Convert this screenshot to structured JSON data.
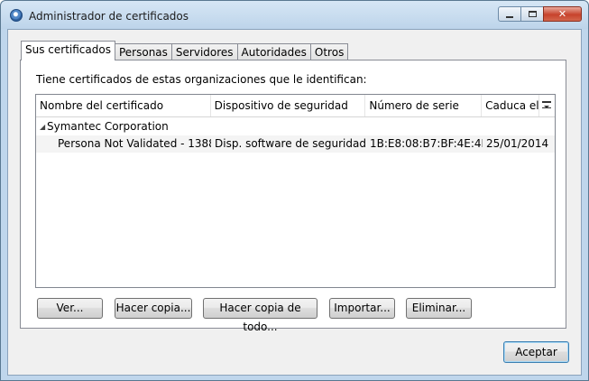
{
  "window": {
    "title": "Administrador de certificados",
    "accent": "#bfd6ec",
    "close_glyph": "✕"
  },
  "tabs": [
    {
      "label": "Sus certificados",
      "active": true
    },
    {
      "label": "Personas",
      "active": false
    },
    {
      "label": "Servidores",
      "active": false
    },
    {
      "label": "Autoridades",
      "active": false
    },
    {
      "label": "Otros",
      "active": false
    }
  ],
  "panel": {
    "intro": "Tiene certificados de estas organizaciones que le identifican:"
  },
  "table": {
    "columns": [
      "Nombre del certificado",
      "Dispositivo de seguridad",
      "Número de serie",
      "Caduca el"
    ],
    "column_picker_icon": "column-picker-icon",
    "groups": [
      {
        "name": "Symantec Corporation",
        "expanded": true,
        "rows": [
          {
            "name": "Persona Not Validated - 13883...",
            "device": "Disp. software de seguridad",
            "serial": "1B:E8:08:B7:BF:4E:4B:4...",
            "expires": "25/01/2014"
          }
        ]
      }
    ]
  },
  "buttons": {
    "view": "Ver...",
    "backup": "Hacer copia...",
    "backup_all": "Hacer copia de todo...",
    "import": "Importar...",
    "delete": "Eliminar..."
  },
  "footer": {
    "ok": "Aceptar"
  }
}
